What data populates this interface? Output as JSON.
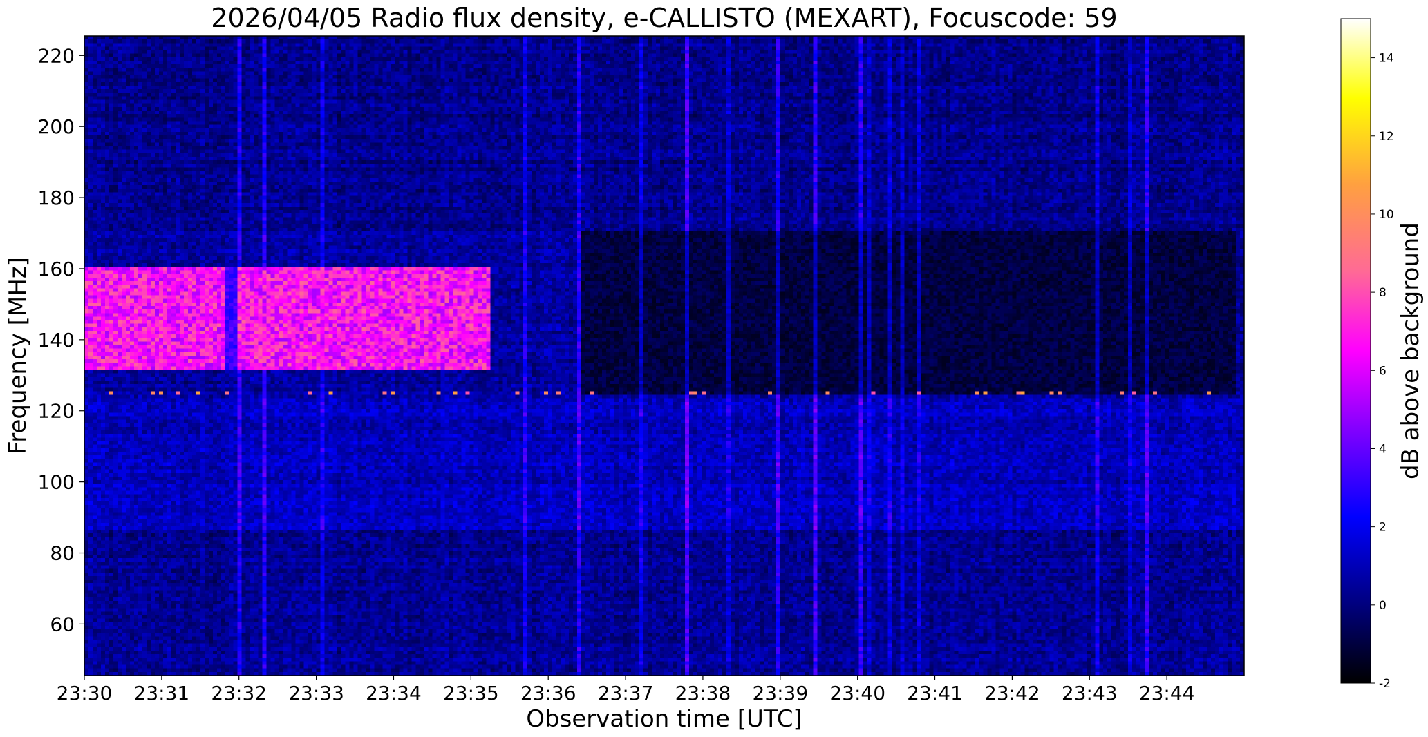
{
  "chart_data": {
    "type": "heatmap",
    "title": "2026/04/05  Radio flux density, e-CALLISTO (MEXART), Focuscode: 59",
    "xlabel": "Observation time [UTC]",
    "ylabel": "Frequency [MHz]",
    "colorbar_label": "dB above background",
    "x_ticks": [
      "23:30",
      "23:31",
      "23:32",
      "23:33",
      "23:34",
      "23:35",
      "23:36",
      "23:37",
      "23:38",
      "23:39",
      "23:40",
      "23:41",
      "23:42",
      "23:43",
      "23:44"
    ],
    "x_range_minutes": [
      0,
      15
    ],
    "y_ticks": [
      60,
      80,
      100,
      120,
      140,
      160,
      180,
      200,
      220
    ],
    "ylim": [
      45.5,
      225.5
    ],
    "colorbar_ticks": [
      -2,
      0,
      2,
      4,
      6,
      8,
      10,
      12,
      14
    ],
    "clim": [
      -2,
      15
    ],
    "colormap": "gnuplot2",
    "colormap_stops": [
      "#000000",
      "#000080",
      "#0000ff",
      "#8000ff",
      "#ff00ff",
      "#ff6a95",
      "#ffa040",
      "#ffff00",
      "#ffffff"
    ],
    "features": [
      {
        "type": "emission_band",
        "time_range": [
          "23:30",
          "23:35:15"
        ],
        "freq_range_mhz": [
          132,
          160
        ],
        "level_db": 6.5
      },
      {
        "type": "depleted_region",
        "time_range": [
          "23:36:25",
          "23:44:55"
        ],
        "freq_range_mhz": [
          125,
          170
        ],
        "level_db": -1.5
      },
      {
        "type": "quiet_band",
        "freq_range_mhz": [
          86,
          124
        ],
        "level_db": 1.2
      }
    ]
  }
}
